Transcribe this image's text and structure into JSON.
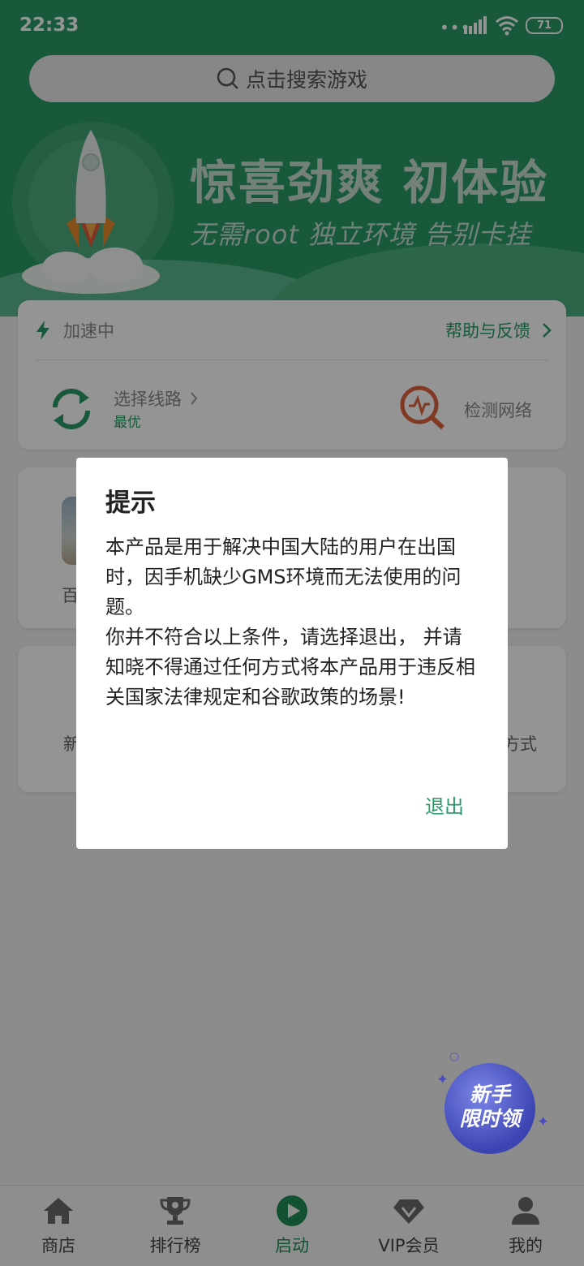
{
  "status_bar": {
    "time": "22:33",
    "dots": "•••",
    "battery": "71"
  },
  "search": {
    "placeholder": "点击搜索游戏"
  },
  "banner": {
    "headline": "惊喜劲爽  初体验",
    "subline": "无需root  独立环境  告别卡挂"
  },
  "accelerator_card": {
    "status": "加速中",
    "help_link": "帮助与反馈",
    "route_label": "选择线路",
    "route_value": "最优",
    "detect_label": "检测网络"
  },
  "game_card": {
    "label_partial": "百"
  },
  "info_card": {
    "left_partial": "新",
    "right_partial": "方式"
  },
  "dialog": {
    "title": "提示",
    "paragraph1": "本产品是用于解决中国大陆的用户在出国时，因手机缺少GMS环境而无法使用的问题。",
    "paragraph2": "你并不符合以上条件，请选择退出， 并请知晓不得通过任何方式将本产品用于违反相关国家法律规定和谷歌政策的场景!",
    "exit_button": "退出"
  },
  "promo_badge": {
    "line1": "新手",
    "line2": "限时领"
  },
  "bottom_nav": {
    "items": [
      {
        "label": "商店",
        "icon": "home-icon"
      },
      {
        "label": "排行榜",
        "icon": "trophy-icon"
      },
      {
        "label": "启动",
        "icon": "play-icon",
        "active": true
      },
      {
        "label": "VIP会员",
        "icon": "diamond-icon"
      },
      {
        "label": "我的",
        "icon": "person-icon"
      }
    ]
  },
  "colors": {
    "brand_green": "#2a9a66",
    "overlay": "rgba(0,0,0,0.42)",
    "promo_blue": "#3c44b2"
  }
}
